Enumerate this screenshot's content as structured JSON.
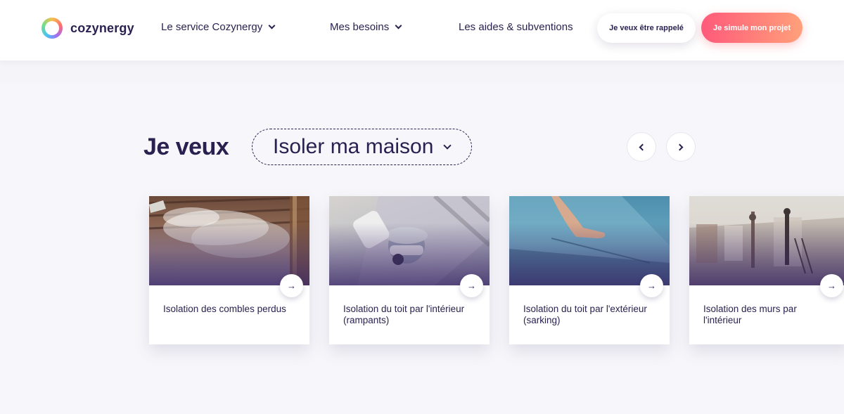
{
  "header": {
    "brand": "cozynergy",
    "nav": [
      {
        "label": "Le service Cozynergy",
        "has_dropdown": true
      },
      {
        "label": "Mes besoins",
        "has_dropdown": true
      },
      {
        "label": "Les aides & subventions",
        "has_dropdown": false
      }
    ],
    "callback_button": "Je veux être rappelé",
    "simulate_button": "Je simule mon projet"
  },
  "selector": {
    "prefix": "Je veux",
    "selected_value": "Isoler ma maison"
  },
  "cards": [
    {
      "title": "Isolation des combles perdus",
      "image_icon": "attic-insulation-photo"
    },
    {
      "title": "Isolation du toit par l'intérieur (rampants)",
      "image_icon": "roof-interior-photo"
    },
    {
      "title": "Isolation du toit par l'extérieur (sarking)",
      "image_icon": "roof-exterior-photo"
    },
    {
      "title": "Isolation des murs par l'intérieur",
      "image_icon": "wall-interior-photo"
    }
  ],
  "colors": {
    "primary_text": "#2b2151",
    "cta_gradient_start": "#ff5a7a",
    "cta_gradient_end": "#ffa07a",
    "background": "#f7f7fb"
  }
}
